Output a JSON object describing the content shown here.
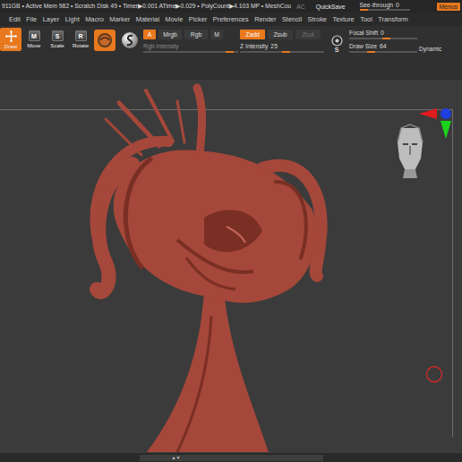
{
  "status_bar": {
    "info": "911GB • Active Mem 982 • Scratch Disk 49 • Timer▶0.001 ATime▶0.029 • PolyCount▶4.103 MP • MeshCou",
    "ac": "AC",
    "quicksave": "QuickSave",
    "see_through": {
      "label": "See-through",
      "value": "0",
      "level": 0
    },
    "menus": {
      "label": "Menus",
      "selected": true
    }
  },
  "menu_bar": [
    "Edit",
    "File",
    "Layer",
    "Light",
    "Macro",
    "Marker",
    "Material",
    "Movie",
    "Picker",
    "Preferences",
    "Render",
    "Stencil",
    "Stroke",
    "Texture",
    "Tool",
    "Transform"
  ],
  "tools": [
    {
      "label": "Draw",
      "kind": "crosshair",
      "key": "",
      "selected": true
    },
    {
      "label": "Move",
      "kind": "key",
      "key": "M",
      "selected": false
    },
    {
      "label": "Scale",
      "kind": "key",
      "key": "S",
      "selected": false
    },
    {
      "label": "Rotate",
      "kind": "key",
      "key": "R",
      "selected": false
    }
  ],
  "color_modes": [
    {
      "label": "A",
      "selected": true
    },
    {
      "label": "Mrgb",
      "selected": false
    },
    {
      "label": "Rgb",
      "selected": false
    },
    {
      "label": "M",
      "selected": false
    }
  ],
  "rgb_intensity": {
    "label": "Rgb Intensity",
    "value": "",
    "level": 0.95,
    "disabled": true
  },
  "z_modes": [
    {
      "label": "Zadd",
      "selected": true,
      "disabled": false
    },
    {
      "label": "Zsub",
      "selected": false,
      "disabled": false
    },
    {
      "label": "Zcut",
      "selected": false,
      "disabled": true
    }
  ],
  "z_intensity": {
    "label": "Z Intensity",
    "value": "25",
    "level": 0.55,
    "disabled": false
  },
  "size_icon": {
    "label": "S"
  },
  "focal_shift": {
    "label": "Focal Shift",
    "value": "0",
    "level": 0.55,
    "disabled": false
  },
  "draw_size": {
    "label": "Draw Size",
    "value": "64",
    "level": 0.3,
    "disabled": false
  },
  "dynamic": {
    "label": "Dynamic",
    "selected": false
  },
  "bottom_bar": {
    "handle": "▲▼"
  }
}
